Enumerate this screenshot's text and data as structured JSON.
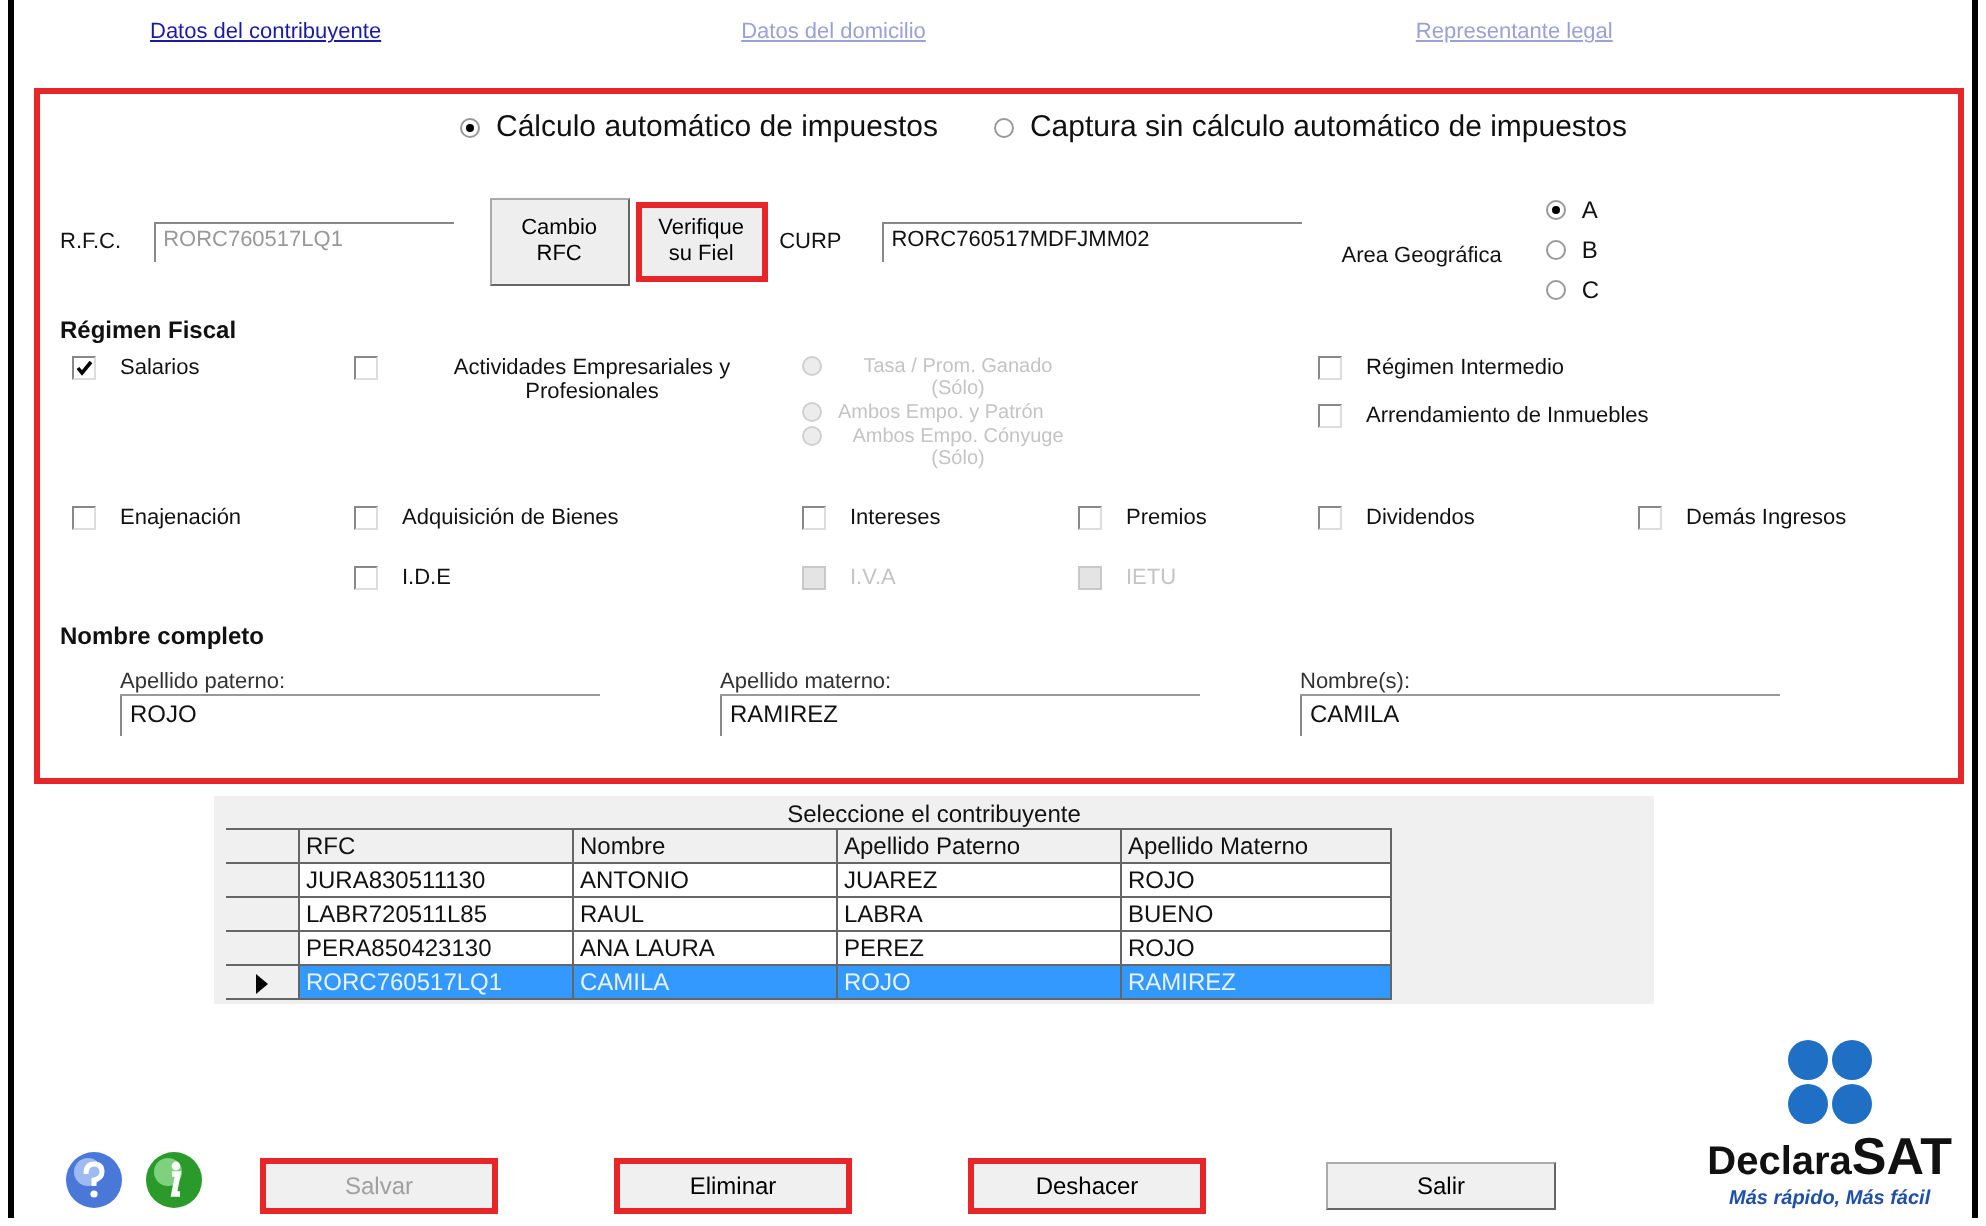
{
  "nav_links": [
    {
      "label": "Datos del contribuyente",
      "disabled": false
    },
    {
      "label": "Datos del domicilio",
      "disabled": true
    },
    {
      "label": "Representante legal",
      "disabled": true
    }
  ],
  "calc_mode": [
    {
      "label": "Cálculo automático de impuestos",
      "selected": true
    },
    {
      "label": "Captura sin cálculo automático de impuestos",
      "selected": false
    }
  ],
  "rfc": {
    "label": "R.F.C.",
    "value": "RORC760517LQ1",
    "disabled": true
  },
  "id_buttons": [
    {
      "label": "Cambio RFC",
      "highlighted": false
    },
    {
      "label": "Verifique su Fiel",
      "highlighted": true
    }
  ],
  "curp": {
    "label": "CURP",
    "value": "RORC760517MDFJMM02"
  },
  "area": {
    "label": "Area Geográfica",
    "options": [
      {
        "label": "A",
        "selected": true
      },
      {
        "label": "B",
        "selected": false
      },
      {
        "label": "C",
        "selected": false
      }
    ]
  },
  "regimen": {
    "title": "Régimen Fiscal",
    "rows": [
      [
        {
          "kind": "checkbox",
          "label": "Salarios",
          "checked": true,
          "disabled": false
        },
        {
          "kind": "checkbox",
          "label": "Actividades Empresariales y Profesionales",
          "checked": false,
          "disabled": false
        },
        {
          "kind": "radios",
          "options": [
            {
              "label": "Tasa / Prom. Ganado (Sólo)",
              "selected": false,
              "disabled": true
            },
            {
              "label": "Ambos Empo. y Patrón",
              "selected": false,
              "disabled": true
            },
            {
              "label": "Ambos Empo. Cónyuge (Sólo)",
              "selected": false,
              "disabled": true
            }
          ]
        },
        {
          "kind": "blank"
        },
        {
          "kind": "checks",
          "options": [
            {
              "label": "Régimen Intermedio",
              "checked": false,
              "disabled": false
            },
            {
              "label": "Arrendamiento de Inmuebles",
              "checked": false,
              "disabled": false
            }
          ]
        }
      ],
      [
        {
          "kind": "checkbox",
          "label": "Enajenación",
          "checked": false,
          "disabled": false
        },
        {
          "kind": "checkbox",
          "label": "Adquisición de Bienes",
          "checked": false,
          "disabled": false
        },
        {
          "kind": "checkbox",
          "label": "Intereses",
          "checked": false,
          "disabled": false
        },
        {
          "kind": "checkbox",
          "label": "Premios",
          "checked": false,
          "disabled": false
        },
        {
          "kind": "checkbox",
          "label": "Dividendos",
          "checked": false,
          "disabled": false
        },
        {
          "kind": "checkbox",
          "label": "Demás Ingresos",
          "checked": false,
          "disabled": false
        }
      ],
      [
        {
          "kind": "blank"
        },
        {
          "kind": "checkbox",
          "label": "I.D.E",
          "checked": false,
          "disabled": false
        },
        {
          "kind": "checkbox",
          "label": "I.V.A",
          "checked": false,
          "disabled": true
        },
        {
          "kind": "checkbox",
          "label": "IETU",
          "checked": false,
          "disabled": true
        }
      ]
    ]
  },
  "nombre": {
    "title": "Nombre completo",
    "fields": [
      {
        "label": "Apellido paterno:",
        "value": "ROJO"
      },
      {
        "label": "Apellido materno:",
        "value": "RAMIREZ"
      },
      {
        "label": "Nombre(s):",
        "value": "CAMILA"
      }
    ]
  },
  "table": {
    "caption": "Seleccione el contribuyente",
    "columns": [
      "RFC",
      "Nombre",
      "Apellido Paterno",
      "Apellido Materno"
    ],
    "rows": [
      {
        "cells": [
          "JURA830511130",
          "ANTONIO",
          "JUAREZ",
          "ROJO"
        ],
        "selected": false
      },
      {
        "cells": [
          "LABR720511L85",
          "RAUL",
          "LABRA",
          "BUENO"
        ],
        "selected": false
      },
      {
        "cells": [
          "PERA850423130",
          "ANA LAURA",
          "PEREZ",
          "ROJO"
        ],
        "selected": false
      },
      {
        "cells": [
          "RORC760517LQ1",
          "CAMILA",
          "ROJO",
          "RAMIREZ"
        ],
        "selected": true
      }
    ]
  },
  "actions": [
    {
      "label": "Salvar",
      "disabled": true,
      "highlighted": true
    },
    {
      "label": "Eliminar",
      "disabled": false,
      "highlighted": true
    },
    {
      "label": "Deshacer",
      "disabled": false,
      "highlighted": true
    },
    {
      "label": "Salir",
      "disabled": false,
      "highlighted": false
    }
  ],
  "logo": {
    "brand": "Declara",
    "brand_bold": "SAT",
    "tagline": "Más rápido, Más fácil"
  }
}
